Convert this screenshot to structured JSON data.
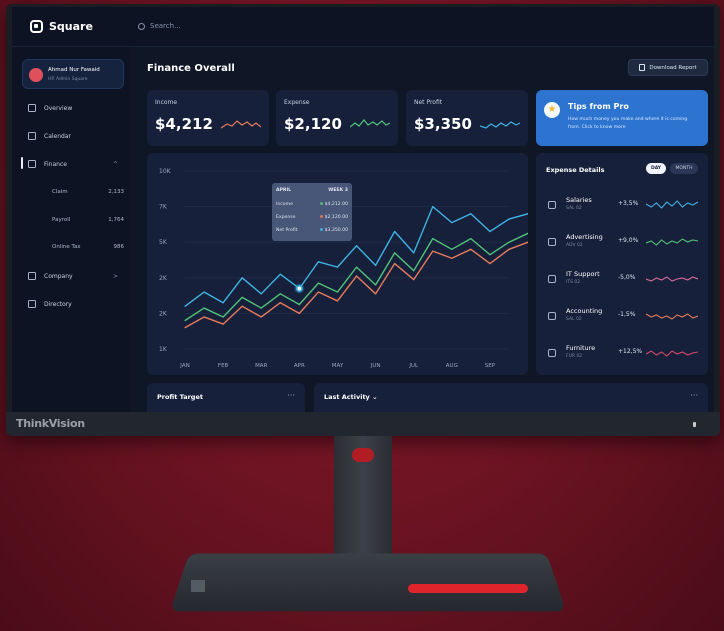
{
  "app": {
    "brand": "Square",
    "search_placeholder": "Search..."
  },
  "bezel": {
    "logo": "ThinkVision"
  },
  "profile": {
    "name": "Ahmad Nur Fawaid",
    "role": "HR Admin Square"
  },
  "sidebar": {
    "items": [
      {
        "label": "Overview",
        "icon": "grid-icon"
      },
      {
        "label": "Calendar",
        "icon": "calendar-icon"
      },
      {
        "label": "Finance",
        "icon": "finance-icon",
        "chevron": "^"
      },
      {
        "label": "Company",
        "icon": "company-icon",
        "chevron": ">"
      },
      {
        "label": "Directory",
        "icon": "directory-icon"
      }
    ],
    "finance_sub": [
      {
        "label": "Claim",
        "count": "2,133"
      },
      {
        "label": "Payroll",
        "count": "1,764"
      },
      {
        "label": "Online Tax",
        "count": "986"
      }
    ]
  },
  "main": {
    "title": "Finance Overall",
    "download_label": "Download Report",
    "stats": [
      {
        "label": "Income",
        "value": "$4,212",
        "color": "#e77b5c"
      },
      {
        "label": "Expense",
        "value": "$2,120",
        "color": "#52c27a"
      },
      {
        "label": "Net Profit",
        "value": "$3,350",
        "color": "#3fb3e4"
      }
    ],
    "tips": {
      "title": "Tips from Pro",
      "text": "How much money you make and where it is coming from. Click to know more"
    }
  },
  "tooltip": {
    "month": "APRIL",
    "week": "WEEK 3",
    "rows": [
      {
        "label": "Income",
        "value": "$4,212.00",
        "color": "#52c27a"
      },
      {
        "label": "Expense",
        "value": "$2,120.00",
        "color": "#e77b5c"
      },
      {
        "label": "Net Profit",
        "value": "$3,350.00",
        "color": "#3fb3e4"
      }
    ]
  },
  "chart_data": {
    "type": "line",
    "categories": [
      "JAN",
      "FEB",
      "MAR",
      "APR",
      "MAY",
      "JUN",
      "JUL",
      "AUG",
      "SEP"
    ],
    "yticks": [
      "10K",
      "7K",
      "5K",
      "2K",
      "2K",
      "1K"
    ],
    "x": [
      0,
      0.5,
      1,
      1.5,
      2,
      2.5,
      3,
      3.5,
      4,
      4.5,
      5,
      5.5,
      6,
      6.5,
      7,
      7.5,
      8,
      8.5,
      9,
      9.5
    ],
    "series": [
      {
        "color": "#3fb3e4",
        "values": [
          2.4,
          3.2,
          2.6,
          4.0,
          3.1,
          4.2,
          3.4,
          4.9,
          4.6,
          5.8,
          4.7,
          6.6,
          5.4,
          8.0,
          7.1,
          7.6,
          6.6,
          7.3,
          7.6,
          8.1
        ]
      },
      {
        "color": "#52c27a",
        "values": [
          1.6,
          2.3,
          1.8,
          2.9,
          2.3,
          3.1,
          2.5,
          3.7,
          3.2,
          4.6,
          3.6,
          5.4,
          4.4,
          6.2,
          5.6,
          6.2,
          5.3,
          6.0,
          6.5,
          7.4
        ]
      },
      {
        "color": "#e77b5c",
        "values": [
          1.2,
          1.8,
          1.4,
          2.4,
          1.8,
          2.6,
          2.0,
          3.2,
          2.7,
          4.1,
          3.1,
          4.8,
          3.9,
          5.5,
          5.1,
          5.6,
          4.8,
          5.6,
          6.0,
          7.1
        ]
      }
    ],
    "ylim": [
      0,
      10
    ],
    "highlight": {
      "series": 0,
      "index": 6
    },
    "grid": true
  },
  "expense_details": {
    "title": "Expense Details",
    "toggle": [
      "DAY",
      "MONTH"
    ],
    "items": [
      {
        "name": "Salaries",
        "sub": "SAL 02",
        "pct": "+3,5%",
        "color": "#3fb3e4",
        "icon": "wallet-icon"
      },
      {
        "name": "Advertising",
        "sub": "ADV 02",
        "pct": "+9,0%",
        "color": "#52c27a",
        "icon": "megaphone-icon"
      },
      {
        "name": "IT Support",
        "sub": "ITS 02",
        "pct": "-5,0%",
        "color": "#d96b9a",
        "icon": "gear-icon"
      },
      {
        "name": "Accounting",
        "sub": "SAL 02",
        "pct": "-1,5%",
        "color": "#e77b5c",
        "icon": "calculator-icon"
      },
      {
        "name": "Furniture",
        "sub": "FUR 02",
        "pct": "+12,5%",
        "color": "#d94a6a",
        "icon": "home-icon"
      }
    ]
  },
  "bottom": {
    "profit_target": "Profit Target",
    "last_activity": "Last Activity",
    "more": "···"
  }
}
